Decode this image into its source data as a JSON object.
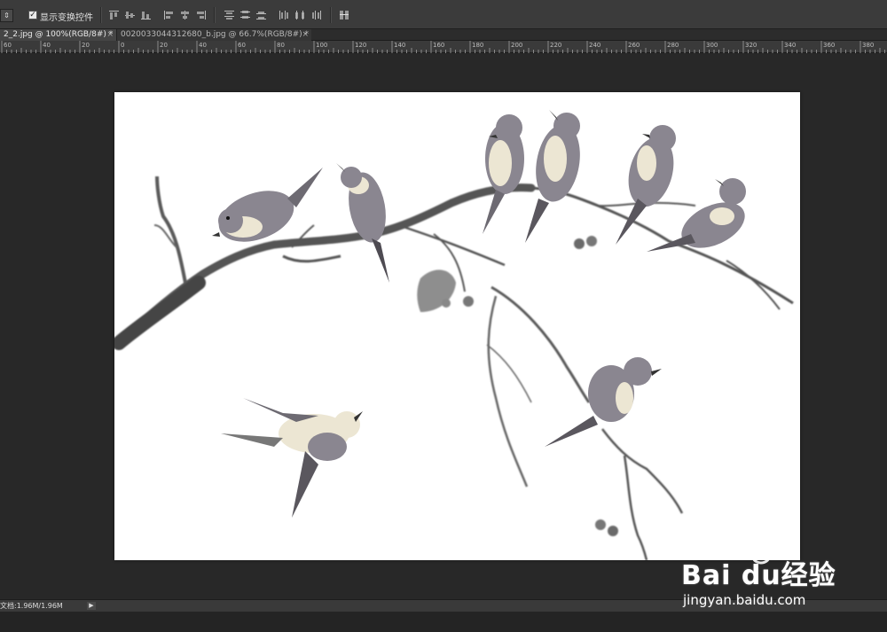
{
  "options_bar": {
    "tool_dropdown_glyph": "⇕",
    "show_transform_controls_checked": true,
    "show_transform_controls_label": "显示变换控件"
  },
  "tabs": [
    {
      "label": "2_2.jpg @ 100%(RGB/8#) *",
      "close": "×",
      "active": true
    },
    {
      "label": "00200330443126​80_b.jpg @ 66.7%(RGB/8#) *",
      "close": "×",
      "active": false
    }
  ],
  "ruler": {
    "ticks": [
      "60",
      "40",
      "20",
      "0",
      "20",
      "40",
      "60",
      "80",
      "100",
      "120",
      "140",
      "160",
      "180",
      "200",
      "220",
      "240",
      "260",
      "280",
      "300",
      "320",
      "340",
      "360",
      "380"
    ]
  },
  "status_bar": {
    "doc_size": "文档:1.96M/1.96M",
    "arrow": "▶"
  },
  "watermark": {
    "brand": "Bai  du经验",
    "url": "jingyan.baidu.com"
  },
  "colors": {
    "ink": "#4a4a4a",
    "bird_body": "#8a8690",
    "bird_cream": "#ece6d3",
    "canvas": "#ffffff",
    "workspace": "#282828"
  }
}
